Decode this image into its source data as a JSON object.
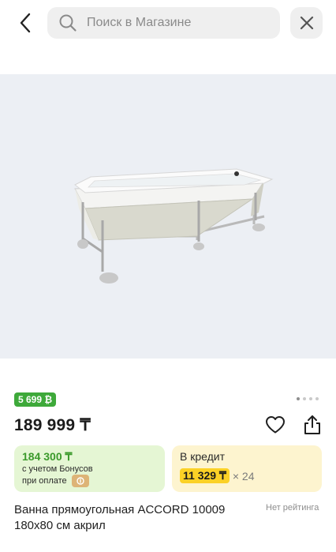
{
  "header": {
    "search_placeholder": "Поиск в Магазине",
    "icons": [
      "back-arrow-icon",
      "search-icon",
      "close-icon"
    ]
  },
  "gallery": {
    "image_name": "bathtub-product-image",
    "background_color": "#eceff4",
    "pages_total": 4,
    "current_page": 1
  },
  "product": {
    "bonus_badge": "5 699 ₿",
    "price": "189 999 ₸",
    "bonus_card": {
      "price": "184 300 ₸",
      "note": "с учетом Бонусов",
      "pay_note": "при оплате"
    },
    "credit_card": {
      "title": "В кредит",
      "amount": "11 329 ₸",
      "multiplier": "× 24"
    },
    "title": "Ванна прямоугольная ACCORD 10009 180х80 см акрил",
    "rating": "Нет рейтинга"
  },
  "colors": {
    "bonus_green": "#3ea93a",
    "bonus_card_bg": "#e5f6d4",
    "credit_card_bg": "#fdf4cf",
    "credit_amount_bg": "#fbd126",
    "kaspi_logo": "#ddb477"
  }
}
